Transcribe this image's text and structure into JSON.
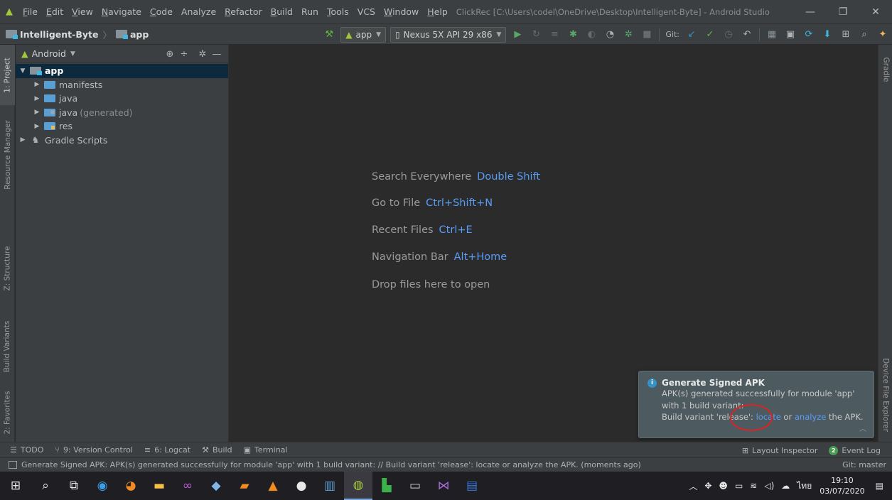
{
  "menubar": {
    "items": [
      {
        "u": "F",
        "rest": "ile"
      },
      {
        "u": "E",
        "rest": "dit"
      },
      {
        "u": "V",
        "rest": "iew"
      },
      {
        "u": "N",
        "rest": "avigate"
      },
      {
        "u": "C",
        "rest": "ode"
      },
      {
        "u": "",
        "rest": "Analyze"
      },
      {
        "u": "R",
        "rest": "efactor"
      },
      {
        "u": "B",
        "rest": "uild"
      },
      {
        "u": "",
        "rest": "Run"
      },
      {
        "u": "T",
        "rest": "ools"
      },
      {
        "u": "",
        "rest": "VCS"
      },
      {
        "u": "W",
        "rest": "indow"
      },
      {
        "u": "H",
        "rest": "elp"
      }
    ],
    "window_title": "ClickRec [C:\\Users\\codel\\OneDrive\\Desktop\\Intelligent-Byte] - Android Studio"
  },
  "navbar": {
    "project": "Intelligent-Byte",
    "module": "app",
    "run_config": "app",
    "device": "Nexus 5X API 29 x86",
    "git_label": "Git:"
  },
  "left_tabs": {
    "project": "1: Project",
    "resource_manager": "Resource Manager",
    "structure": "Z: Structure",
    "build_variants": "Build Variants",
    "favorites": "2: Favorites"
  },
  "right_tabs": {
    "gradle": "Gradle",
    "device_explorer": "Device File Explorer"
  },
  "project_panel": {
    "view": "Android",
    "tree": {
      "app": "app",
      "manifests": "manifests",
      "java": "java",
      "java_gen": "java",
      "java_gen_suffix": "(generated)",
      "res": "res",
      "gradle_scripts": "Gradle Scripts"
    }
  },
  "editor_hints": [
    {
      "label": "Search Everywhere",
      "key": "Double Shift"
    },
    {
      "label": "Go to File",
      "key": "Ctrl+Shift+N"
    },
    {
      "label": "Recent Files",
      "key": "Ctrl+E"
    },
    {
      "label": "Navigation Bar",
      "key": "Alt+Home"
    },
    {
      "label": "Drop files here to open",
      "key": ""
    }
  ],
  "notification": {
    "title": "Generate Signed APK",
    "line1": "APK(s) generated successfully for module 'app'",
    "line2": "with 1 build variant:",
    "line3_prefix": "Build variant 'release': ",
    "locate": "locate",
    "or": " or ",
    "analyze": "analyze",
    "line3_suffix": " the APK."
  },
  "bottom_tools": {
    "todo": "TODO",
    "version_control": "9: Version Control",
    "logcat": "6: Logcat",
    "build": "Build",
    "terminal": "Terminal",
    "layout_inspector": "Layout Inspector",
    "event_log": "Event Log",
    "event_count": "2"
  },
  "status": {
    "message": "Generate Signed APK: APK(s) generated successfully for module 'app' with 1 build variant: // Build variant 'release': locate or analyze the APK. (moments ago)",
    "branch": "Git: master"
  },
  "taskbar": {
    "lang": "ไทย",
    "time": "19:10",
    "date": "03/07/2020"
  }
}
